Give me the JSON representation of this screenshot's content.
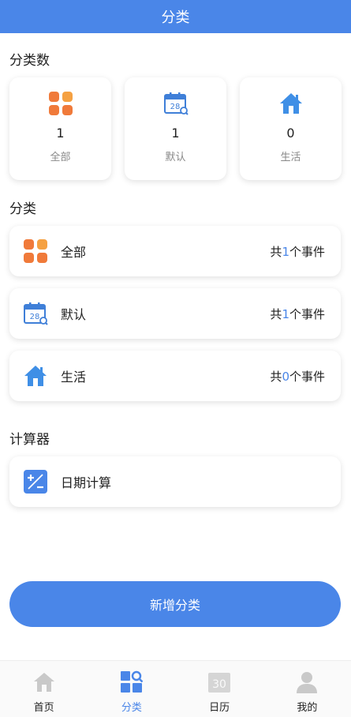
{
  "header": {
    "title": "分类"
  },
  "stats_section": {
    "title": "分类数"
  },
  "stats": [
    {
      "count": "1",
      "label": "全部",
      "icon": "grid-icon"
    },
    {
      "count": "1",
      "label": "默认",
      "icon": "calendar-icon"
    },
    {
      "count": "0",
      "label": "生活",
      "icon": "home-icon"
    }
  ],
  "category_section": {
    "title": "分类"
  },
  "categories": [
    {
      "name": "全部",
      "prefix": "共",
      "count": "1",
      "suffix": "个事件",
      "icon": "grid-icon"
    },
    {
      "name": "默认",
      "prefix": "共",
      "count": "1",
      "suffix": "个事件",
      "icon": "calendar-icon"
    },
    {
      "name": "生活",
      "prefix": "共",
      "count": "0",
      "suffix": "个事件",
      "icon": "home-icon"
    }
  ],
  "calculator_section": {
    "title": "计算器"
  },
  "calculator": {
    "label": "日期计算",
    "icon": "calculator-icon"
  },
  "add_button": {
    "label": "新增分类"
  },
  "tabbar": [
    {
      "label": "首页",
      "icon": "home-icon",
      "active": false
    },
    {
      "label": "分类",
      "icon": "category-search-icon",
      "active": true
    },
    {
      "label": "日历",
      "icon": "calendar-30-icon",
      "active": false
    },
    {
      "label": "我的",
      "icon": "user-icon",
      "active": false
    }
  ],
  "colors": {
    "primary": "#4a86e8",
    "orange": "#f07a3a",
    "sky": "#3f8fe6"
  }
}
